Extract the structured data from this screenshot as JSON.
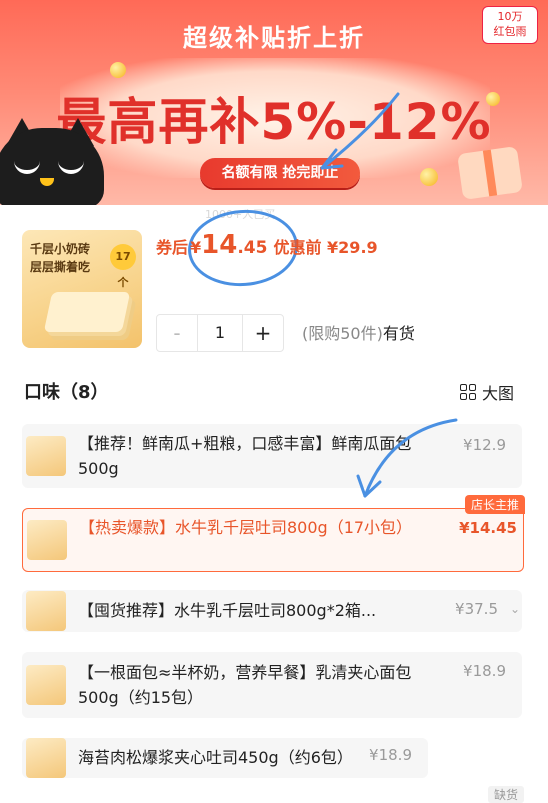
{
  "banner": {
    "title": "超级补贴折上折",
    "headline": "最高再补5%-12%",
    "pill": "名额有限 抢完即止",
    "redpacket_line1": "10万",
    "redpacket_line2": "红包雨",
    "buyers_faint": "1000+人已买"
  },
  "product": {
    "thumb_line1": "千层小奶砖",
    "thumb_line2": "层层撕着吃",
    "thumb_badge": "17个",
    "price_label": "券后",
    "price_yen": "¥",
    "price_int": "14",
    "price_dec": ".45",
    "original_price": "优惠前 ¥29.9",
    "quantity": "1",
    "minus": "-",
    "plus": "+",
    "limit_text": "(限购50件)",
    "stock_text": "有货"
  },
  "flavors": {
    "title": "口味（8）",
    "big_view": "大图",
    "owner_tag": "店长主推",
    "stock_tag": "缺货",
    "items": [
      {
        "text": "【推荐！鲜南瓜+粗粮，口感丰富】鲜南瓜面包500g",
        "price": "¥12.9"
      },
      {
        "text": "【热卖爆款】水牛乳千层吐司800g（17小包）",
        "price": "¥14.45"
      },
      {
        "text": "【囤货推荐】水牛乳千层吐司800g*2箱...",
        "price": "¥37.5"
      },
      {
        "text": "【一根面包≈半杯奶，营养早餐】乳清夹心面包500g（约15包）",
        "price": "¥18.9"
      },
      {
        "text": "海苔肉松爆浆夹心吐司450g（约6包）",
        "price": "¥18.9"
      }
    ]
  }
}
